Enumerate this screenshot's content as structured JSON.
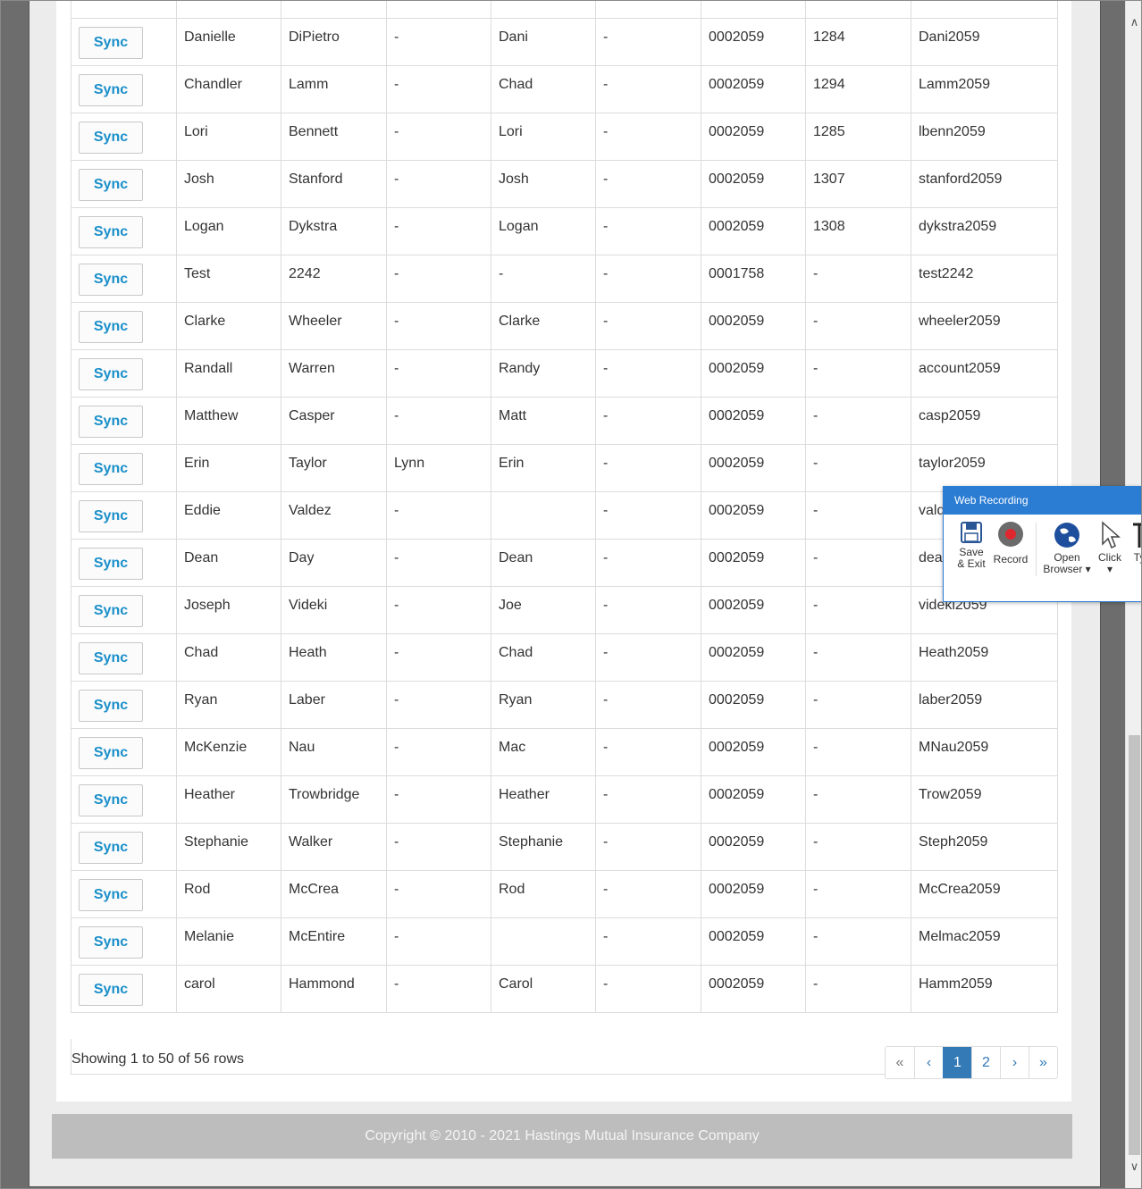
{
  "table": {
    "sync_label": "Sync",
    "rows": [
      [
        "Danielle",
        "DiPietro",
        "-",
        "Dani",
        "-",
        "0002059",
        "1284",
        "Dani2059"
      ],
      [
        "Chandler",
        "Lamm",
        "-",
        "Chad",
        "-",
        "0002059",
        "1294",
        "Lamm2059"
      ],
      [
        "Lori",
        "Bennett",
        "-",
        "Lori",
        "-",
        "0002059",
        "1285",
        "lbenn2059"
      ],
      [
        "Josh",
        "Stanford",
        "-",
        "Josh",
        "-",
        "0002059",
        "1307",
        "stanford2059"
      ],
      [
        "Logan",
        "Dykstra",
        "-",
        "Logan",
        "-",
        "0002059",
        "1308",
        "dykstra2059"
      ],
      [
        "Test",
        "2242",
        "-",
        "-",
        "-",
        "0001758",
        "-",
        "test2242"
      ],
      [
        "Clarke",
        "Wheeler",
        "-",
        "Clarke",
        "-",
        "0002059",
        "-",
        "wheeler2059"
      ],
      [
        "Randall",
        "Warren",
        "-",
        "Randy",
        "-",
        "0002059",
        "-",
        "account2059"
      ],
      [
        "Matthew",
        "Casper",
        "-",
        "Matt",
        "-",
        "0002059",
        "-",
        "casp2059"
      ],
      [
        "Erin",
        "Taylor",
        "Lynn",
        "Erin",
        "-",
        "0002059",
        "-",
        "taylor2059"
      ],
      [
        "Eddie",
        "Valdez",
        "-",
        "",
        "-",
        "0002059",
        "-",
        "vald"
      ],
      [
        "Dean",
        "Day",
        "-",
        "Dean",
        "-",
        "0002059",
        "-",
        "dea"
      ],
      [
        "Joseph",
        "Videki",
        "-",
        "Joe",
        "-",
        "0002059",
        "-",
        "videki2059"
      ],
      [
        "Chad",
        "Heath",
        "-",
        "Chad",
        "-",
        "0002059",
        "-",
        "Heath2059"
      ],
      [
        "Ryan",
        "Laber",
        "-",
        "Ryan",
        "-",
        "0002059",
        "-",
        "laber2059"
      ],
      [
        "McKenzie",
        "Nau",
        "-",
        "Mac",
        "-",
        "0002059",
        "-",
        "MNau2059"
      ],
      [
        "Heather",
        "Trowbridge",
        "-",
        "Heather",
        "-",
        "0002059",
        "-",
        "Trow2059"
      ],
      [
        "Stephanie",
        "Walker",
        "-",
        "Stephanie",
        "-",
        "0002059",
        "-",
        "Steph2059"
      ],
      [
        "Rod",
        "McCrea",
        "-",
        "Rod",
        "-",
        "0002059",
        "-",
        "McCrea2059"
      ],
      [
        "Melanie",
        "McEntire",
        "-",
        "",
        "-",
        "0002059",
        "-",
        "Melmac2059"
      ],
      [
        "carol",
        "Hammond",
        "-",
        "Carol",
        "-",
        "0002059",
        "-",
        "Hamm2059"
      ]
    ]
  },
  "footer": {
    "rows_info": "Showing 1 to 50 of 56 rows",
    "pagination": [
      "«",
      "‹",
      "1",
      "2",
      "›",
      "»"
    ],
    "active_page": "1"
  },
  "copyright": "Copyright © 2010 - 2021 Hastings Mutual Insurance Company",
  "web_recording": {
    "title": "Web Recording",
    "tools": [
      {
        "label1": "Save",
        "label2": "& Exit",
        "icon": "save-icon"
      },
      {
        "label1": "Record",
        "label2": "",
        "icon": "record-icon"
      },
      {
        "label1": "Open",
        "label2": "Browser ▾",
        "icon": "globe-icon"
      },
      {
        "label1": "Click",
        "label2": "▾",
        "icon": "cursor-icon"
      },
      {
        "label1": "Ty",
        "label2": "",
        "icon": "type-icon"
      }
    ]
  },
  "colors": {
    "accent": "#2b7cd3",
    "sync_text": "#1a8fc9",
    "page_active": "#337ab7"
  }
}
